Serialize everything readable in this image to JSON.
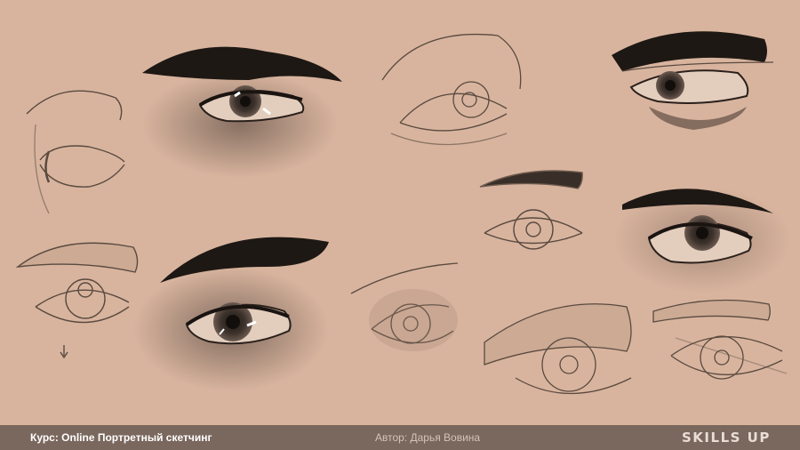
{
  "footer": {
    "course": "Курс: Online Портретный скетчинг",
    "author": "Автор: Дарья Вовина",
    "logo": "SKILLS UP"
  },
  "colors": {
    "background": "#d8b49e",
    "footer_bar": "#7a675d",
    "sketch_line": "#5a4a40",
    "shadow": "#3a2d26"
  },
  "artwork": {
    "icon_names": [
      "eye-sketch-icon"
    ]
  }
}
